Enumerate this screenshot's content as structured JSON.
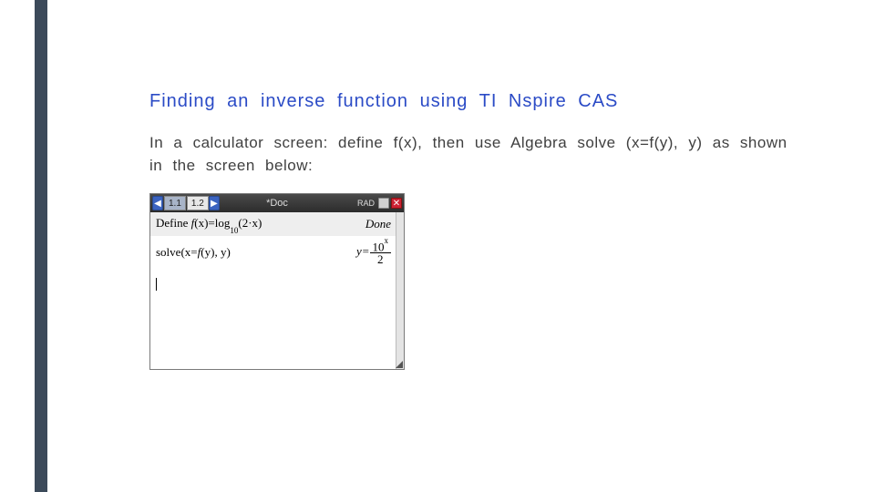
{
  "heading": "Finding an inverse function using TI Nspire CAS",
  "body": "In a calculator screen: define f(x), then use Algebra solve (x=f(y), y) as shown in the screen below:",
  "calc": {
    "nav_left": "◀",
    "tab1": "1.1",
    "tab2": "1.2",
    "nav_right": "▶",
    "doc": "*Doc",
    "rad": "RAD",
    "close": "✕",
    "row1": {
      "prefix": "Define ",
      "fn_name": "f",
      "fn_arg": "(x)",
      "eq": "=log",
      "base": "10",
      "arg": "(2·x)",
      "result": "Done"
    },
    "row2": {
      "cmd_name": "solve",
      "cmd_open": "(",
      "xeq": "x=",
      "fname": "f",
      "farg": "(y)",
      "comma_y": ", y",
      "cmd_close": ")",
      "res_y": "y=",
      "res_num_base": "10",
      "res_num_exp": "x",
      "res_den": "2"
    }
  }
}
